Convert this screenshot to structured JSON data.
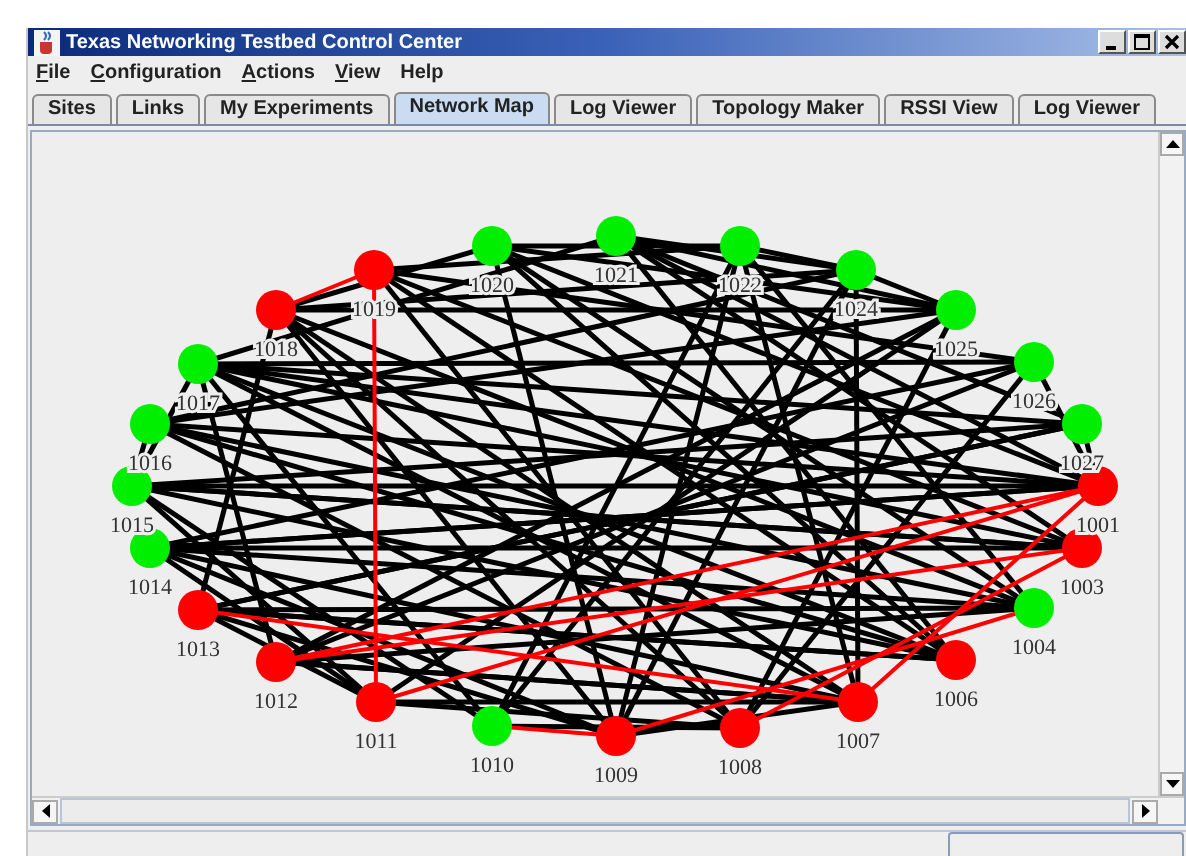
{
  "window": {
    "title": "Texas Networking Testbed Control Center"
  },
  "menu": [
    {
      "label": "File",
      "mnemonic": true
    },
    {
      "label": "Configuration",
      "mnemonic": true
    },
    {
      "label": "Actions",
      "mnemonic": true
    },
    {
      "label": "View",
      "mnemonic": true
    },
    {
      "label": "Help",
      "mnemonic": false
    }
  ],
  "tabs": [
    {
      "label": "Sites",
      "selected": false
    },
    {
      "label": "Links",
      "selected": false
    },
    {
      "label": "My Experiments",
      "selected": false
    },
    {
      "label": "Network Map",
      "selected": true
    },
    {
      "label": "Log Viewer",
      "selected": false
    },
    {
      "label": "Topology Maker",
      "selected": false
    },
    {
      "label": "RSSI View",
      "selected": false
    },
    {
      "label": "Log Viewer",
      "selected": false
    }
  ],
  "network_map": {
    "nodes": [
      {
        "label": "1001",
        "color": "#ff0000"
      },
      {
        "label": "1003",
        "color": "#ff0000"
      },
      {
        "label": "1004",
        "color": "#00ee00"
      },
      {
        "label": "1006",
        "color": "#ff0000"
      },
      {
        "label": "1007",
        "color": "#ff0000"
      },
      {
        "label": "1008",
        "color": "#ff0000"
      },
      {
        "label": "1009",
        "color": "#ff0000"
      },
      {
        "label": "1010",
        "color": "#00ee00"
      },
      {
        "label": "1011",
        "color": "#ff0000"
      },
      {
        "label": "1012",
        "color": "#ff0000"
      },
      {
        "label": "1013",
        "color": "#ff0000"
      },
      {
        "label": "1014",
        "color": "#00ee00"
      },
      {
        "label": "1015",
        "color": "#00ee00"
      },
      {
        "label": "1016",
        "color": "#00ee00"
      },
      {
        "label": "1017",
        "color": "#00ee00"
      },
      {
        "label": "1018",
        "color": "#ff0000"
      },
      {
        "label": "1019",
        "color": "#ff0000"
      },
      {
        "label": "1020",
        "color": "#00ee00"
      },
      {
        "label": "1021",
        "color": "#00ee00"
      },
      {
        "label": "1022",
        "color": "#00ee00"
      },
      {
        "label": "1024",
        "color": "#00ee00"
      },
      {
        "label": "1025",
        "color": "#00ee00"
      },
      {
        "label": "1026",
        "color": "#00ee00"
      },
      {
        "label": "1027",
        "color": "#00ee00"
      }
    ]
  }
}
